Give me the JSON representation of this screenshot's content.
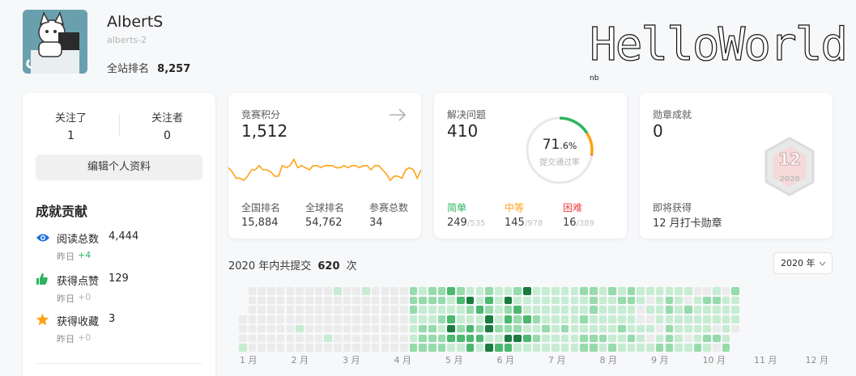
{
  "profile": {
    "name": "AlbertS",
    "username": "alberts-2",
    "rank_label": "全站排名",
    "rank_value": "8,257",
    "banner_text": "HelloWorld",
    "banner_sup": "nb"
  },
  "follow": {
    "following_label": "关注了",
    "following_value": "1",
    "followers_label": "关注者",
    "followers_value": "0",
    "edit_button": "编辑个人资料"
  },
  "achievements": {
    "title": "成就贡献",
    "items": [
      {
        "icon": "eye-icon",
        "label": "阅读总数",
        "value": "4,444",
        "sub_label": "昨日",
        "sub_value": "+4"
      },
      {
        "icon": "thumbs-up-icon",
        "label": "获得点赞",
        "value": "129",
        "sub_label": "昨日",
        "sub_value": "+0"
      },
      {
        "icon": "star-icon",
        "label": "获得收藏",
        "value": "3",
        "sub_label": "昨日",
        "sub_value": "+0"
      }
    ]
  },
  "contest": {
    "label": "竞赛积分",
    "score": "1,512",
    "stats": [
      {
        "label": "全国排名",
        "value": "15,884"
      },
      {
        "label": "全球排名",
        "value": "54,762"
      },
      {
        "label": "参赛总数",
        "value": "34"
      }
    ],
    "sparkline": [
      22,
      20,
      17,
      17,
      16,
      18,
      21,
      21,
      23,
      21,
      21,
      20,
      18,
      18,
      23,
      22,
      23,
      26,
      22,
      23,
      22,
      21,
      23,
      23,
      22,
      23,
      23,
      23,
      22,
      22,
      23,
      22,
      23,
      23,
      22,
      23,
      23,
      21,
      23,
      23,
      21,
      19,
      16,
      18,
      18,
      17,
      21,
      22,
      21,
      17,
      21
    ]
  },
  "problems": {
    "label": "解决问题",
    "solved": "410",
    "rate_int": "71",
    "rate_dec": ".6%",
    "rate_label": "提交通过率",
    "rate_fraction": 0.716,
    "levels": [
      {
        "name": "简单",
        "solved": "249",
        "total": "535",
        "color": "#2db55d"
      },
      {
        "name": "中等",
        "solved": "145",
        "total": "978",
        "color": "#ffa116"
      },
      {
        "name": "困难",
        "solved": "16",
        "total": "389",
        "color": "#ef4743"
      }
    ]
  },
  "badges": {
    "label": "勋章成就",
    "count": "0",
    "badge_number": "12",
    "badge_year": "2020",
    "upcoming_label": "即将获得",
    "upcoming_name": "12 月打卡勋章"
  },
  "heatmap": {
    "prefix": "2020 年内共提交",
    "count": "620",
    "suffix": "次",
    "year_select": "2020 年",
    "months": [
      "1 月",
      "2 月",
      "3 月",
      "4 月",
      "5 月",
      "6 月",
      "7 月",
      "8 月",
      "9 月",
      "10 月",
      "11 月",
      "12 月"
    ],
    "colors": [
      "#ebebeb",
      "#c6ecd2",
      "#96dbab",
      "#4cb86f",
      "#1b7b3f"
    ]
  }
}
